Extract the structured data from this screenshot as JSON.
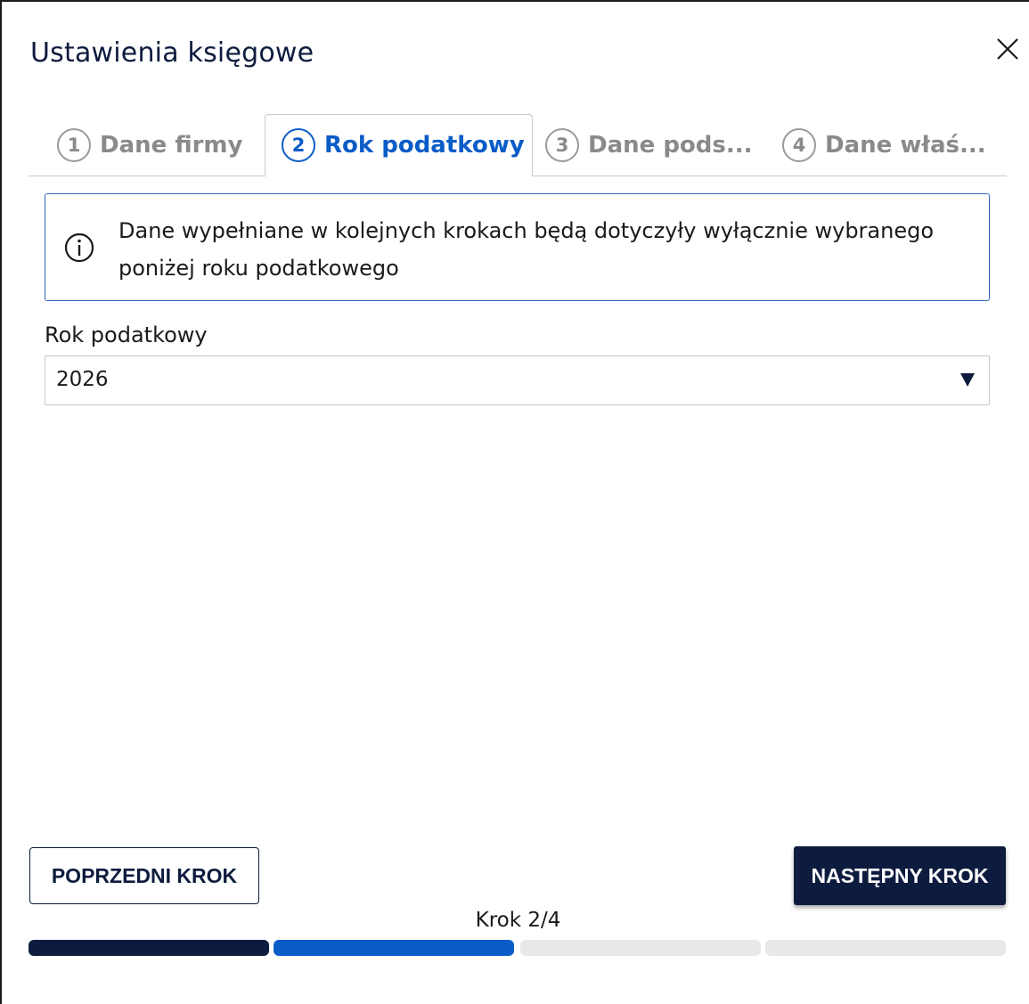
{
  "dialog": {
    "title": "Ustawienia księgowe",
    "close_icon": "close-icon"
  },
  "tabs": [
    {
      "number": "1",
      "label": "Dane firmy",
      "state": "inactive"
    },
    {
      "number": "2",
      "label": "Rok podatkowy",
      "state": "active"
    },
    {
      "number": "3",
      "label": "Dane pods...",
      "state": "inactive"
    },
    {
      "number": "4",
      "label": "Dane właś...",
      "state": "inactive"
    }
  ],
  "info": {
    "icon": "info-icon",
    "text": "Dane wypełniane w kolejnych krokach będą dotyczyły wyłącznie wybranego poniżej roku podatkowego"
  },
  "tax_year": {
    "label": "Rok podatkowy",
    "value": "2026",
    "arrow_icon": "dropdown-arrow-icon"
  },
  "buttons": {
    "prev_label": "POPRZEDNI KROK",
    "next_label": "NASTĘPNY KROK"
  },
  "progress": {
    "label": "Krok 2/4",
    "current_step": 2,
    "total_steps": 4,
    "segments": [
      "done",
      "current",
      "pending",
      "pending"
    ]
  },
  "colors": {
    "primary_dark": "#0d1b3e",
    "accent_blue": "#0a5cc7",
    "pending_gray": "#e8e8e8",
    "info_border": "#2f64b8"
  }
}
